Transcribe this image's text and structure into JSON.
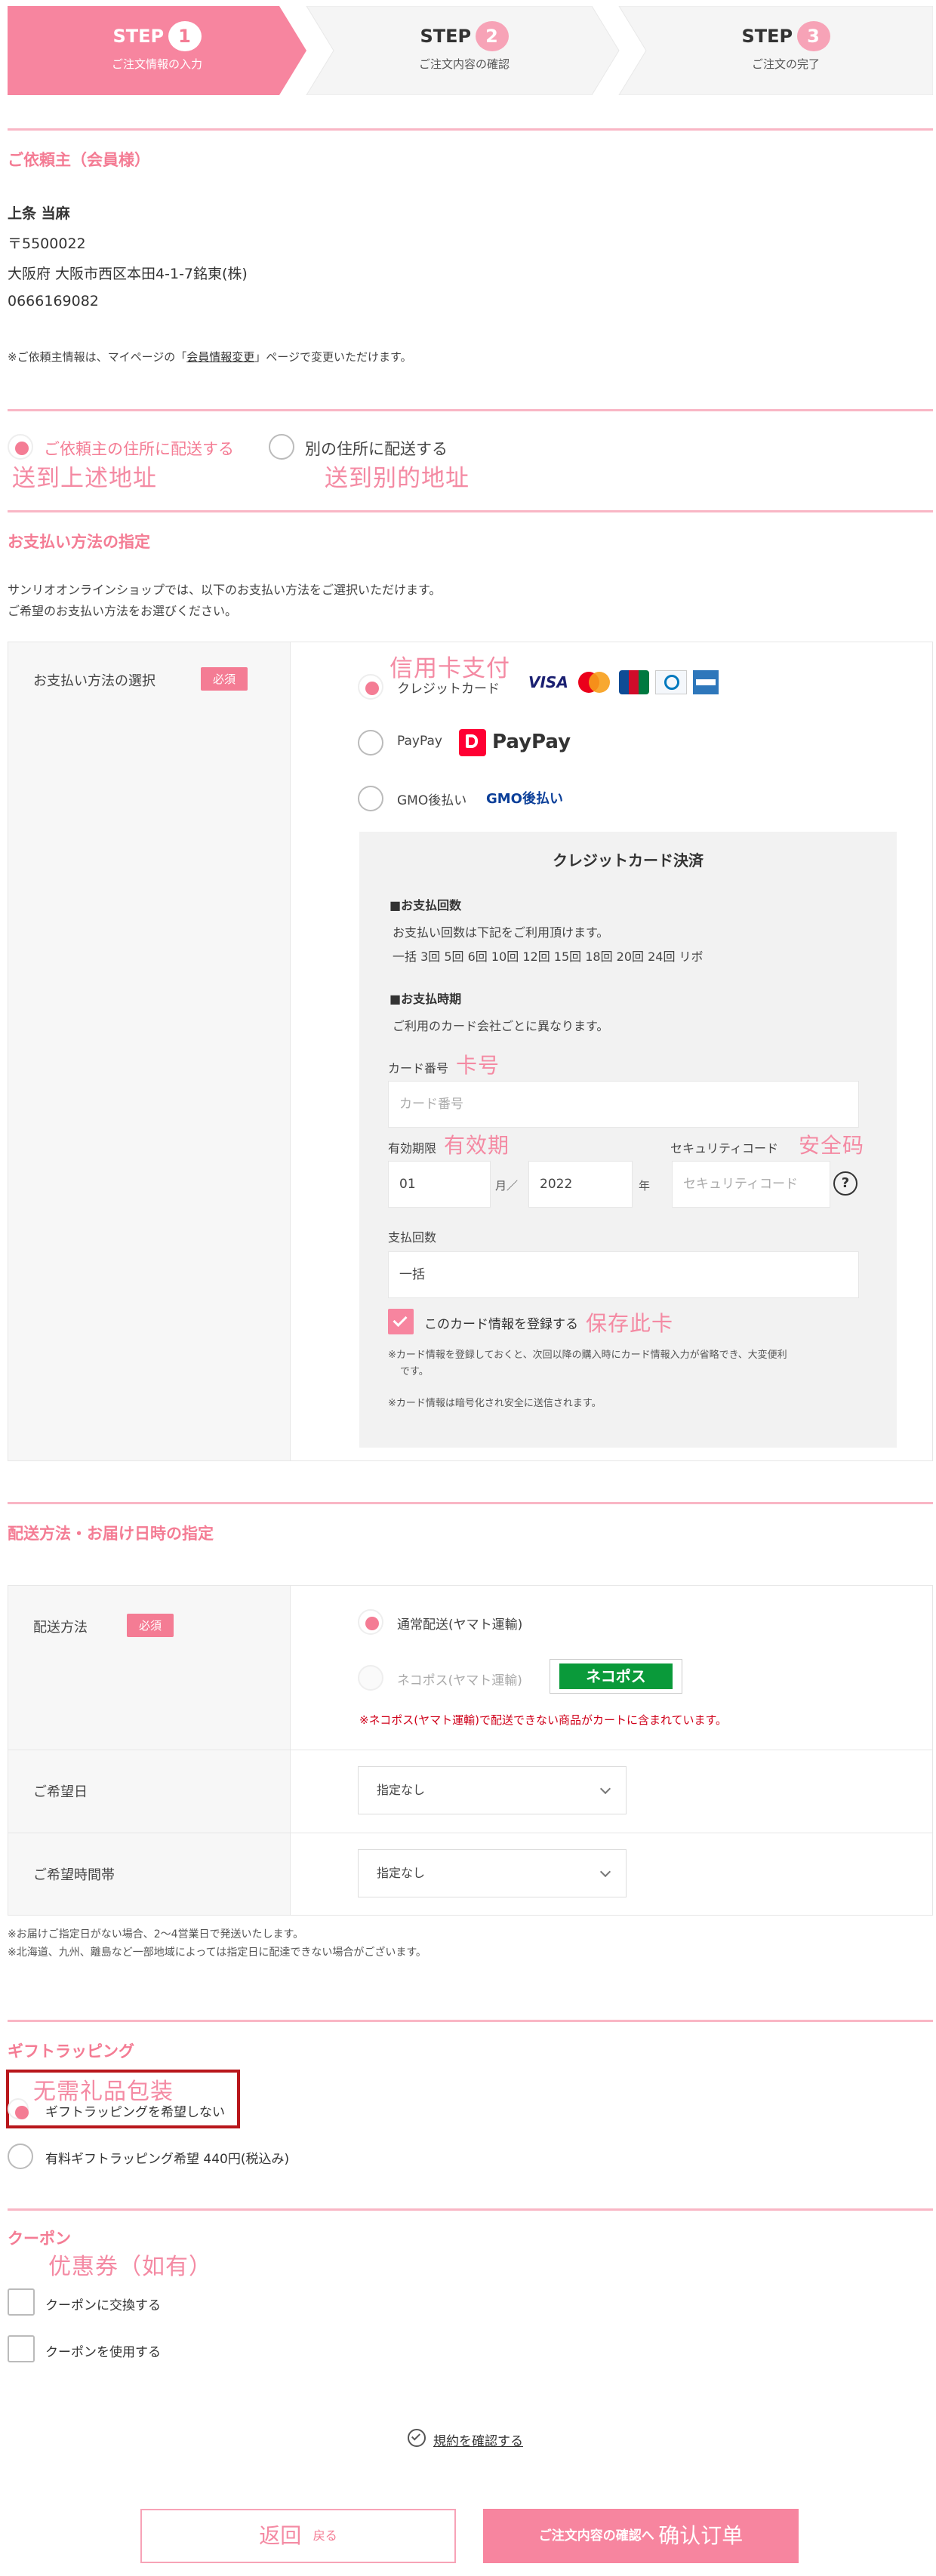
{
  "steps": [
    {
      "label": "STEP",
      "num": "1",
      "sub": "ご注文情報の入力"
    },
    {
      "label": "STEP",
      "num": "2",
      "sub": "ご注文内容の確認"
    },
    {
      "label": "STEP",
      "num": "3",
      "sub": "ご注文の完了"
    }
  ],
  "requester": {
    "title": "ご依頼主（会員様）",
    "name": "上条 当麻",
    "postal": "〒5500022",
    "address": "大阪府  大阪市西区本田4-1-7銘東(株)",
    "phone": "0666169082",
    "note_pre": "※ご依頼主情報は、マイページの「",
    "note_link": "会員情報変更",
    "note_post": "」ページで変更いただけます。"
  },
  "delivery_target": {
    "option1": "ご依頼主の住所に配送する",
    "option1_annot": "送到上述地址",
    "option2": "別の住所に配送する",
    "option2_annot": "送到别的地址"
  },
  "payment": {
    "title": "お支払い方法の指定",
    "intro1": "サンリオオンラインショップでは、以下のお支払い方法をご選択いただけます。",
    "intro2": "ご希望のお支払い方法をお選びください。",
    "select_label": "お支払い方法の選択",
    "required": "必須",
    "credit_annot": "信用卡支付",
    "credit_label": "クレジットカード",
    "card_brands": [
      "VISA",
      "MC",
      "JCB",
      "DC",
      "AMEX"
    ],
    "paypay_label": "PayPay",
    "paypay_logo": "PayPay",
    "gmo_label": "GMO後払い",
    "gmo_logo": "GMO後払い",
    "card_box_title": "クレジットカード決済",
    "installments_head": "■お支払回数",
    "installments_text": "お支払い回数は下記をご利用頂けます。",
    "installments_options": "一括 3回 5回 6回 10回 12回 15回 18回 20回 24回 リボ",
    "timing_head": "■お支払時期",
    "timing_text": "ご利用のカード会社ごとに異なります。",
    "card_number_label": "カード番号",
    "card_number_annot": "卡号",
    "card_number_placeholder": "カード番号",
    "expiry_label": "有効期限",
    "expiry_annot": "有效期",
    "expiry_month": "01",
    "month_unit": "月／",
    "expiry_year": "2022",
    "year_unit": "年",
    "security_label": "セキュリティコード",
    "security_annot": "安全码",
    "security_placeholder": "セキュリティコード",
    "help": "?",
    "count_label": "支払回数",
    "count_value": "一括",
    "save_card_label": "このカード情報を登録する",
    "save_card_annot": "保存此卡",
    "save_note1": "※カード情報を登録しておくと、次回以降の購入時にカード情報入力が省略でき、大変便利",
    "save_note2": "です。",
    "secure_note": "※カード情報は暗号化され安全に送信されます。"
  },
  "shipping": {
    "title": "配送方法・お届け日時の指定",
    "method_label": "配送方法",
    "required": "必須",
    "option1": "通常配送(ヤマト運輸)",
    "option2": "ネコポス(ヤマト運輸)",
    "nekopos_logo": "ネコポス",
    "warning": "※ネコポス(ヤマト運輸)で配送できない商品がカートに含まれています。",
    "date_label": "ご希望日",
    "date_value": "指定なし",
    "time_label": "ご希望時間帯",
    "time_value": "指定なし",
    "note1": "※お届けご指定日がない場合、2〜4営業日で発送いたします。",
    "note2": "※北海道、九州、離島など一部地域によっては指定日に配達できない場合がございます。"
  },
  "gift": {
    "title": "ギフトラッピング",
    "annot": "无需礼品包装",
    "option1": "ギフトラッピングを希望しない",
    "option2": "有料ギフトラッピング希望 440円(税込み)"
  },
  "coupon": {
    "title": "クーポン",
    "annot": "优惠券（如有）",
    "option1": "クーポンに交換する",
    "option2": "クーポンを使用する"
  },
  "terms_link": "規約を確認する",
  "buttons": {
    "back_annot": "返回",
    "back_label": "戻る",
    "confirm_label": "ご注文内容の確認へ",
    "confirm_annot": "确认订单"
  },
  "colors": {
    "accent": "#f47c94",
    "accent_light": "#f9b6c5",
    "highlight_box": "#b8161b",
    "warning": "#d0021b"
  }
}
